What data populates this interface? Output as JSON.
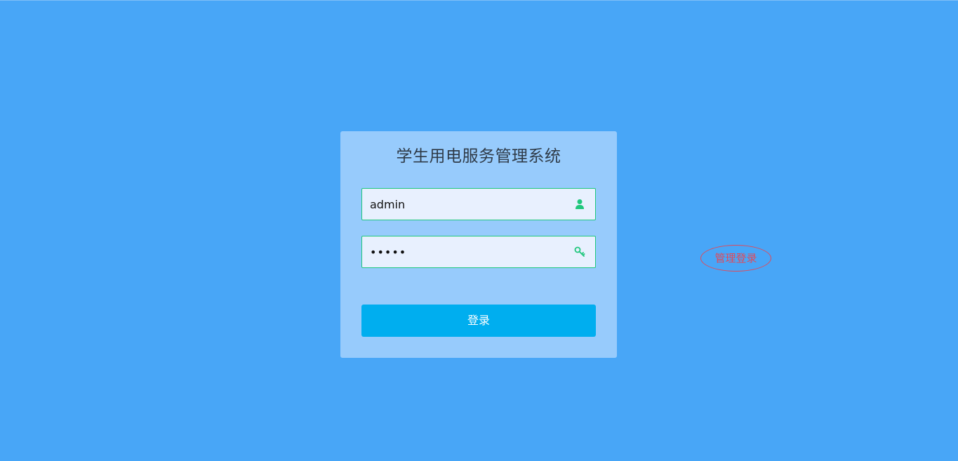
{
  "login": {
    "title": "学生用电服务管理系统",
    "username": {
      "value": "admin",
      "icon": "user-icon"
    },
    "password": {
      "value": "•••••",
      "icon": "key-icon"
    },
    "submit_label": "登录"
  },
  "admin_link": {
    "label": "管理登录"
  },
  "colors": {
    "background": "#48a6f7",
    "card": "#97cbfc",
    "field_border": "#20c77d",
    "icon": "#20c77d",
    "button": "#00aeef",
    "admin_link": "#e04a5a"
  }
}
